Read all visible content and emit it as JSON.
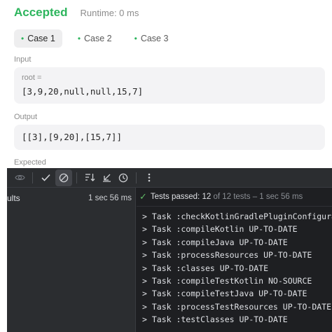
{
  "result": {
    "status": "Accepted",
    "runtime": "Runtime: 0 ms",
    "status_color": "#2db55d"
  },
  "cases": [
    {
      "label": "Case 1",
      "active": true
    },
    {
      "label": "Case 2",
      "active": false
    },
    {
      "label": "Case 3",
      "active": false
    }
  ],
  "input": {
    "section_label": "Input",
    "var_name": "root =",
    "value": "[3,9,20,null,null,15,7]"
  },
  "output": {
    "section_label": "Output",
    "value": "[[3],[9,20],[15,7]]"
  },
  "expected": {
    "section_label": "Expected"
  },
  "ide": {
    "toolbar_icons": [
      "eye-icon",
      "check-icon",
      "stop-circle-icon",
      "sort-icon",
      "collapse-icon",
      "history-clock-icon",
      "more-vertical-icon"
    ],
    "tree_row": {
      "label": "ults",
      "duration": "1 sec 56 ms"
    },
    "test_status": {
      "prefix": "Tests passed:",
      "count": "12",
      "suffix": "of 12 tests – 1 sec 56 ms",
      "pass_color": "#5fb865"
    },
    "console_lines": [
      "> Task :checkKotlinGradlePluginConfigura",
      "> Task :compileKotlin UP-TO-DATE",
      "> Task :compileJava UP-TO-DATE",
      "> Task :processResources UP-TO-DATE",
      "> Task :classes UP-TO-DATE",
      "> Task :compileTestKotlin NO-SOURCE",
      "> Task :compileTestJava UP-TO-DATE",
      "> Task :processTestResources UP-TO-DATE",
      "> Task :testClasses UP-TO-DATE"
    ]
  }
}
